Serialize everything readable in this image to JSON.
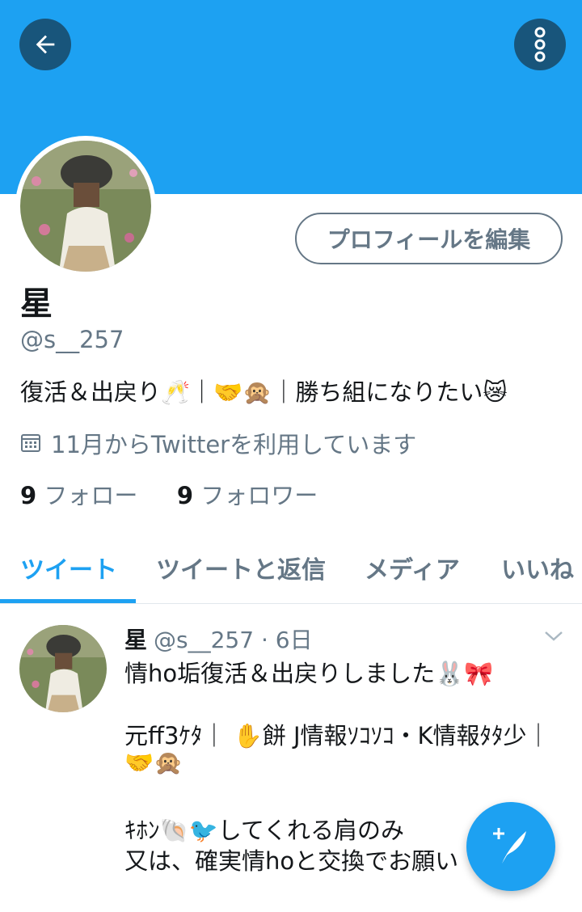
{
  "colors": {
    "accent": "#1da1f2",
    "secondary_text": "#657786",
    "primary_text": "#14171a"
  },
  "header": {
    "back_icon": "arrow-left-icon",
    "more_icon": "more-vertical-icon"
  },
  "profile": {
    "edit_button": "プロフィールを編集",
    "name": "星",
    "handle": "@s__257",
    "bio": "復活＆出戻り🥂｜🤝🙊｜勝ち組になりたい😿",
    "joined": "11月からTwitterを利用しています",
    "following_count": "9",
    "following_label": "フォロー",
    "followers_count": "9",
    "followers_label": "フォロワー"
  },
  "tabs": [
    {
      "label": "ツイート"
    },
    {
      "label": "ツイートと返信"
    },
    {
      "label": "メディア"
    },
    {
      "label": "いいね"
    }
  ],
  "tweet": {
    "name": "星",
    "handle": "@s__257",
    "time": "· 6日",
    "lines": [
      "情ho垢復活＆出戻りしました🐰🎀",
      "",
      "元ff3ｹﾀ｜ ✋餅 J情報ｿｺｿｺ・K情報ﾀﾀ少｜",
      "🤝🙊",
      "",
      "ｷﾎﾝ🐚🐦してくれる肩のみ",
      "又は、確実情hoと交換でお願い"
    ]
  },
  "fab": {
    "icon": "compose-tweet-icon"
  }
}
